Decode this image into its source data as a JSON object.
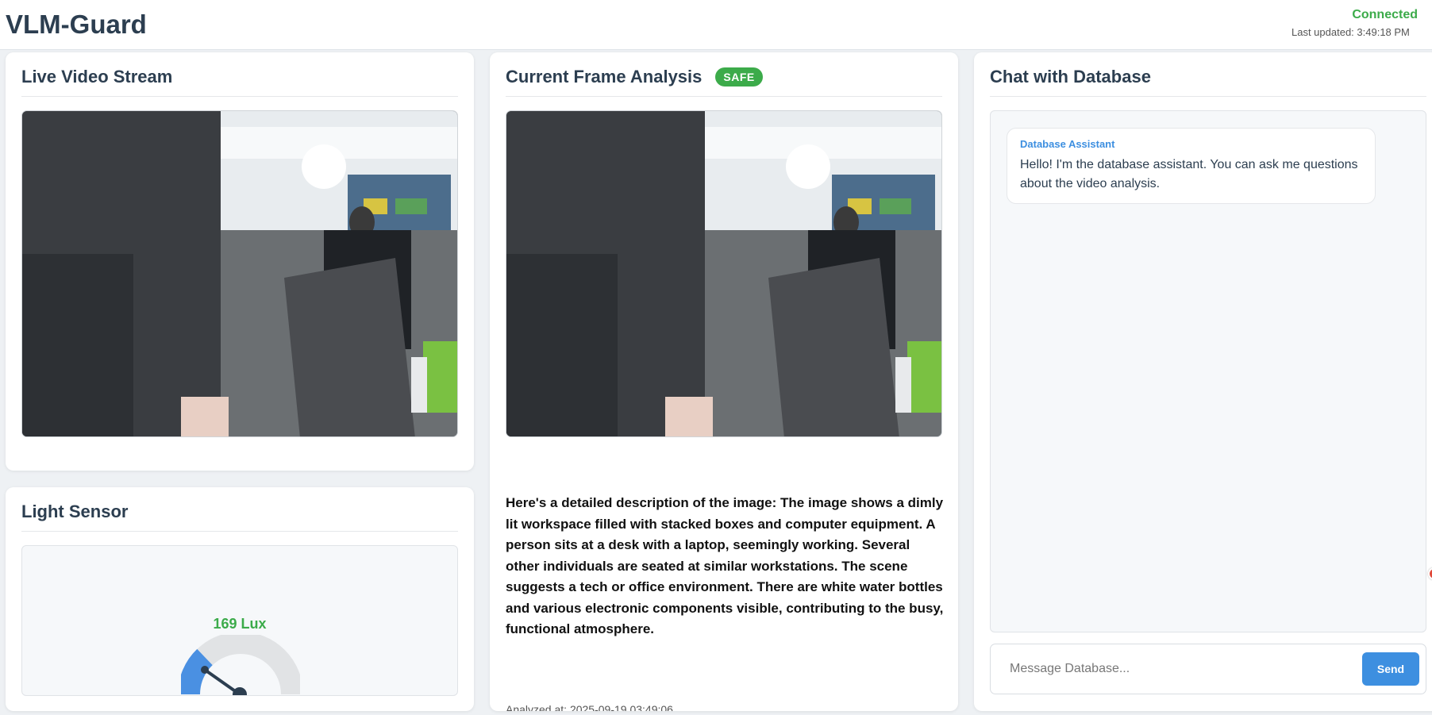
{
  "header": {
    "brand": "VLM-Guard",
    "connection_status": "Connected",
    "last_updated": "Last updated: 3:49:18 PM"
  },
  "live_stream": {
    "title": "Live Video Stream"
  },
  "frame_analysis": {
    "title": "Current Frame Analysis",
    "status_badge": "SAFE",
    "description": "Here's a detailed description of the image: The image shows a dimly lit workspace filled with stacked boxes and computer equipment. A person sits at a desk with a laptop, seemingly working. Several other individuals are seated at similar workstations. The scene suggests a tech or office environment. There are white water bottles and various electronic components visible, contributing to the busy, functional atmosphere.",
    "analyzed_at": "Analyzed at: 2025-09-19 03:49:06"
  },
  "light_sensor": {
    "title": "Light Sensor",
    "reading": "169 Lux"
  },
  "chat": {
    "title": "Chat with Database",
    "messages": [
      {
        "sender": "Database Assistant",
        "text": "Hello! I'm the database assistant. You can ask me questions about the video analysis."
      }
    ],
    "input_placeholder": "Message Database...",
    "send_label": "Send"
  },
  "colors": {
    "safe": "#3cab4a",
    "accent": "#3d8fe0",
    "title": "#2c3e50"
  }
}
